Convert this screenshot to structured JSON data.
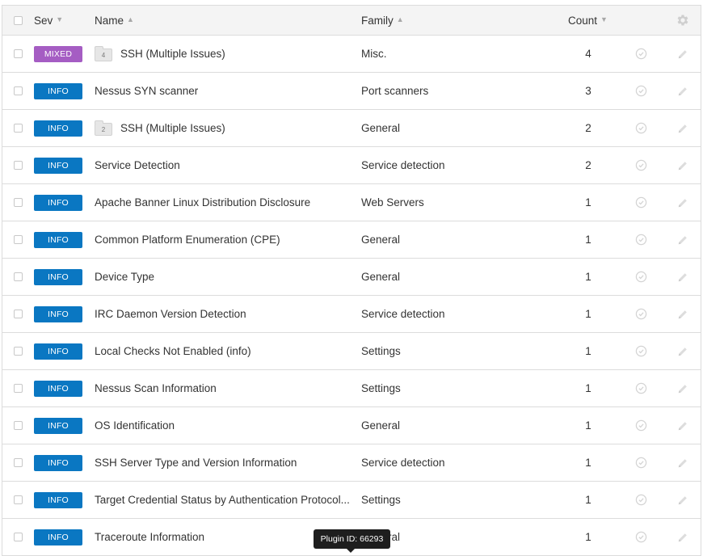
{
  "header": {
    "sev_label": "Sev",
    "name_label": "Name",
    "family_label": "Family",
    "count_label": "Count",
    "sev_sort": "▼",
    "name_sort": "▲",
    "family_sort": "▲",
    "count_sort": "▼"
  },
  "rows": [
    {
      "severity": "MIXED",
      "group_count": "4",
      "name": "SSH (Multiple Issues)",
      "family": "Misc.",
      "count": "4"
    },
    {
      "severity": "INFO",
      "group_count": "",
      "name": "Nessus SYN scanner",
      "family": "Port scanners",
      "count": "3"
    },
    {
      "severity": "INFO",
      "group_count": "2",
      "name": "SSH (Multiple Issues)",
      "family": "General",
      "count": "2"
    },
    {
      "severity": "INFO",
      "group_count": "",
      "name": "Service Detection",
      "family": "Service detection",
      "count": "2"
    },
    {
      "severity": "INFO",
      "group_count": "",
      "name": "Apache Banner Linux Distribution Disclosure",
      "family": "Web Servers",
      "count": "1"
    },
    {
      "severity": "INFO",
      "group_count": "",
      "name": "Common Platform Enumeration (CPE)",
      "family": "General",
      "count": "1"
    },
    {
      "severity": "INFO",
      "group_count": "",
      "name": "Device Type",
      "family": "General",
      "count": "1"
    },
    {
      "severity": "INFO",
      "group_count": "",
      "name": "IRC Daemon Version Detection",
      "family": "Service detection",
      "count": "1"
    },
    {
      "severity": "INFO",
      "group_count": "",
      "name": "Local Checks Not Enabled (info)",
      "family": "Settings",
      "count": "1"
    },
    {
      "severity": "INFO",
      "group_count": "",
      "name": "Nessus Scan Information",
      "family": "Settings",
      "count": "1"
    },
    {
      "severity": "INFO",
      "group_count": "",
      "name": "OS Identification",
      "family": "General",
      "count": "1"
    },
    {
      "severity": "INFO",
      "group_count": "",
      "name": "SSH Server Type and Version Information",
      "family": "Service detection",
      "count": "1"
    },
    {
      "severity": "INFO",
      "group_count": "",
      "name": "Target Credential Status by Authentication Protocol...",
      "family": "Settings",
      "count": "1"
    },
    {
      "severity": "INFO",
      "group_count": "",
      "name": "Traceroute Information",
      "family": "General",
      "count": "1"
    }
  ],
  "tooltip": {
    "text": "Plugin ID: 66293"
  },
  "colors": {
    "info": "#0a77c2",
    "mixed": "#a55dc3"
  },
  "icons": {
    "settings": "gear-icon",
    "snooze": "snooze-clock-icon",
    "edit": "pencil-icon",
    "group": "folder-icon"
  }
}
